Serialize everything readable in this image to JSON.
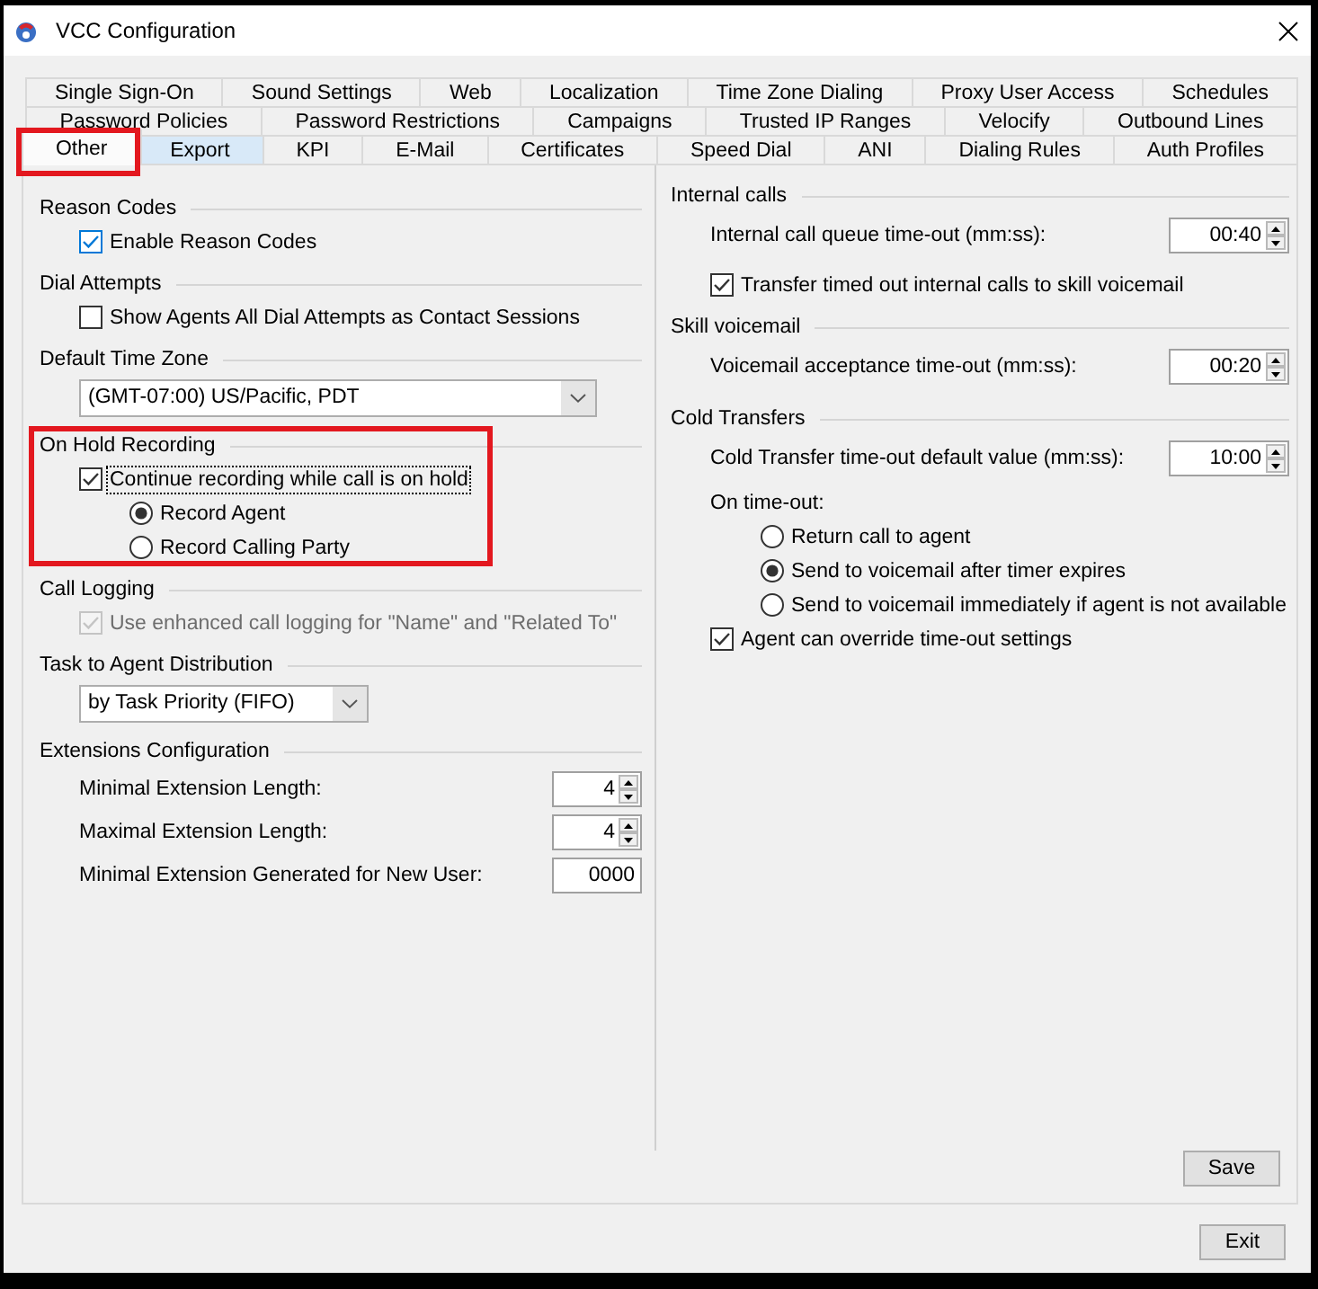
{
  "window": {
    "title": "VCC Configuration"
  },
  "tab_rows": [
    {
      "tabs": [
        {
          "label": "Single Sign-On",
          "selected": false,
          "hovered": false,
          "highlighted": false
        },
        {
          "label": "Sound Settings",
          "selected": false,
          "hovered": false,
          "highlighted": false
        },
        {
          "label": "Web",
          "selected": false,
          "hovered": false,
          "highlighted": false
        },
        {
          "label": "Localization",
          "selected": false,
          "hovered": false,
          "highlighted": false
        },
        {
          "label": "Time Zone Dialing",
          "selected": false,
          "hovered": false,
          "highlighted": false
        },
        {
          "label": "Proxy User Access",
          "selected": false,
          "hovered": false,
          "highlighted": false
        },
        {
          "label": "Schedules",
          "selected": false,
          "hovered": false,
          "highlighted": false
        }
      ]
    },
    {
      "tabs": [
        {
          "label": "Password Policies",
          "selected": false,
          "hovered": false,
          "highlighted": false
        },
        {
          "label": "Password Restrictions",
          "selected": false,
          "hovered": false,
          "highlighted": false
        },
        {
          "label": "Campaigns",
          "selected": false,
          "hovered": false,
          "highlighted": false
        },
        {
          "label": "Trusted IP Ranges",
          "selected": false,
          "hovered": false,
          "highlighted": false
        },
        {
          "label": "Velocify",
          "selected": false,
          "hovered": false,
          "highlighted": false
        },
        {
          "label": "Outbound Lines",
          "selected": false,
          "hovered": false,
          "highlighted": false
        }
      ]
    },
    {
      "tabs": [
        {
          "label": "Other",
          "selected": true,
          "hovered": false,
          "highlighted": true
        },
        {
          "label": "Export",
          "selected": false,
          "hovered": true,
          "highlighted": false
        },
        {
          "label": "KPI",
          "selected": false,
          "hovered": false,
          "highlighted": false
        },
        {
          "label": "E-Mail",
          "selected": false,
          "hovered": false,
          "highlighted": false
        },
        {
          "label": "Certificates",
          "selected": false,
          "hovered": false,
          "highlighted": false
        },
        {
          "label": "Speed Dial",
          "selected": false,
          "hovered": false,
          "highlighted": false
        },
        {
          "label": "ANI",
          "selected": false,
          "hovered": false,
          "highlighted": false
        },
        {
          "label": "Dialing Rules",
          "selected": false,
          "hovered": false,
          "highlighted": false
        },
        {
          "label": "Auth Profiles",
          "selected": false,
          "hovered": false,
          "highlighted": false
        }
      ]
    }
  ],
  "left_sections": [
    {
      "title": "Reason Codes",
      "highlighted": false,
      "items": [
        {
          "kind": "checkbox",
          "label": "Enable Reason Codes",
          "checked": true,
          "disabled": false,
          "hovered": true,
          "focused": false
        }
      ]
    },
    {
      "title": "Dial Attempts",
      "highlighted": false,
      "items": [
        {
          "kind": "checkbox",
          "label": "Show Agents All Dial Attempts as Contact Sessions",
          "checked": false,
          "disabled": false,
          "hovered": false,
          "focused": false
        }
      ]
    },
    {
      "title": "Default Time Zone",
      "highlighted": false,
      "items": [
        {
          "kind": "dropdown",
          "value": "(GMT-07:00) US/Pacific, PDT"
        }
      ]
    },
    {
      "title": "On Hold Recording",
      "highlighted": true,
      "items": [
        {
          "kind": "checkbox",
          "label": "Continue recording while call is on hold",
          "checked": true,
          "disabled": false,
          "hovered": false,
          "focused": true,
          "children": [
            {
              "label": "Record Agent",
              "selected": true
            },
            {
              "label": "Record Calling Party",
              "selected": false
            }
          ]
        }
      ]
    },
    {
      "title": "Call Logging",
      "highlighted": false,
      "items": [
        {
          "kind": "checkbox",
          "label": "Use enhanced call logging for \"Name\" and \"Related To\"",
          "checked": true,
          "disabled": true,
          "hovered": false,
          "focused": false
        }
      ]
    },
    {
      "title": "Task to Agent Distribution",
      "highlighted": false,
      "items": [
        {
          "kind": "dropdown",
          "value": "by Task Priority (FIFO)"
        }
      ]
    },
    {
      "title": "Extensions Configuration",
      "highlighted": false,
      "items": [
        {
          "kind": "spinner",
          "label": "Minimal Extension Length:",
          "value": "4"
        },
        {
          "kind": "spinner",
          "label": "Maximal Extension Length:",
          "value": "4"
        },
        {
          "kind": "textbox",
          "label": "Minimal Extension Generated for New User:",
          "value": "0000"
        }
      ]
    }
  ],
  "right_sections": [
    {
      "title": "Internal calls",
      "items": [
        {
          "kind": "spinner",
          "label": "Internal call queue time-out (mm:ss):",
          "value": "00:40"
        },
        {
          "kind": "checkbox",
          "label": "Transfer timed out internal calls to skill voicemail",
          "checked": true,
          "disabled": false,
          "hovered": false,
          "focused": false
        }
      ]
    },
    {
      "title": "Skill voicemail",
      "items": [
        {
          "kind": "spinner",
          "label": "Voicemail acceptance time-out (mm:ss):",
          "value": "00:20"
        }
      ]
    },
    {
      "title": "Cold Transfers",
      "items": [
        {
          "kind": "spinner",
          "label": "Cold Transfer time-out default value (mm:ss):",
          "value": "10:00"
        },
        {
          "kind": "label",
          "label": "On time-out:",
          "children": [
            {
              "label": "Return call to agent",
              "selected": false
            },
            {
              "label": "Send to voicemail after timer expires",
              "selected": true
            },
            {
              "label": "Send to voicemail immediately if agent is not available",
              "selected": false
            }
          ]
        },
        {
          "kind": "checkbox",
          "label": "Agent can override time-out settings",
          "checked": true,
          "disabled": false,
          "hovered": false,
          "focused": false
        }
      ]
    }
  ],
  "panel_button": {
    "label": "Save"
  },
  "footer_button": {
    "label": "Exit"
  }
}
